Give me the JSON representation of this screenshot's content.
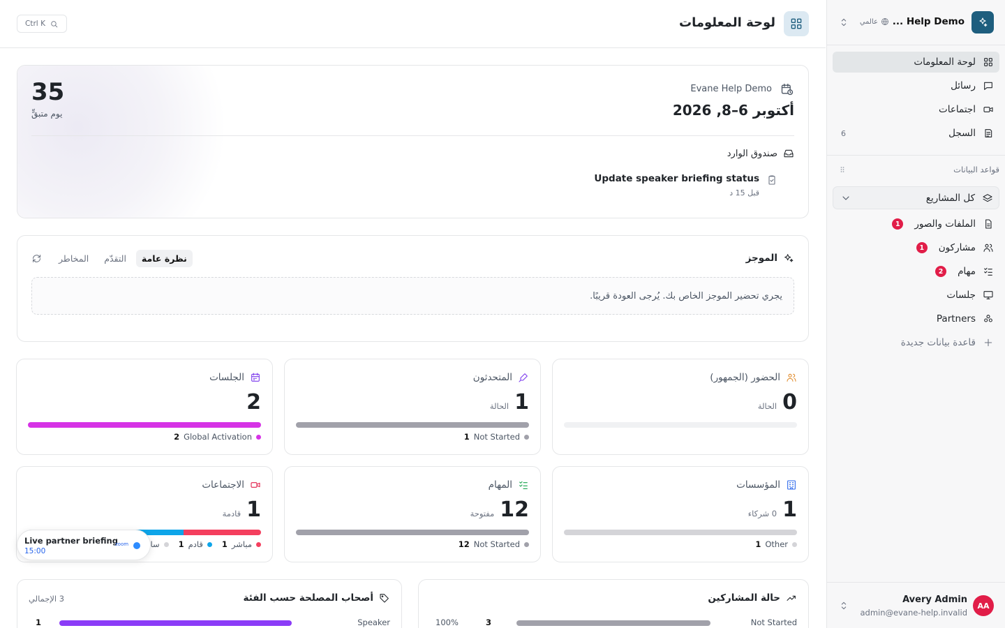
{
  "workspace": {
    "name": "Help Demo ...",
    "scope": "عالمي"
  },
  "header": {
    "title": "لوحة المعلومات",
    "search_shortcut": "Ctrl K"
  },
  "nav": [
    {
      "label": "لوحة المعلومات",
      "icon": "dashboard-icon",
      "active": true
    },
    {
      "label": "رسائل",
      "icon": "message-icon"
    },
    {
      "label": "اجتماعات",
      "icon": "video-icon"
    },
    {
      "label": "السجل",
      "icon": "log-icon",
      "count": "6"
    }
  ],
  "databases": {
    "section_title": "قواعد البيانات",
    "all_label": "كل المشاريع",
    "items": [
      {
        "label": "الملفات والصور",
        "badge": "1"
      },
      {
        "label": "مشاركون",
        "badge": "1"
      },
      {
        "label": "مهام",
        "badge": "2"
      },
      {
        "label": "جلسات"
      },
      {
        "label": "Partners"
      }
    ],
    "new_label": "قاعدة بيانات جديدة"
  },
  "user": {
    "initials": "AA",
    "name": "Avery Admin",
    "email": "admin@evane-help.invalid"
  },
  "event": {
    "name": "Evane Help Demo",
    "dates": "أكتوبر 6–8, 2026",
    "days_left": "35",
    "days_label": "يوم متبقٍّ",
    "inbox_title": "صندوق الوارد",
    "inbox_item": {
      "title": "Update speaker briefing status",
      "time": "قبل 15 د"
    }
  },
  "briefing": {
    "title": "الموجز",
    "tabs": [
      "نظرة عامة",
      "التقدّم",
      "المخاطر"
    ],
    "message": "يجري تحضير الموجز الخاص بك. يُرجى العودة قريبًا."
  },
  "stats": [
    {
      "title": "الحضور (الجمهور)",
      "value": "0",
      "label": "الحالة",
      "icon": "users-icon",
      "icon_color": "#e08a2b",
      "segments": [],
      "legend": []
    },
    {
      "title": "المتحدثون",
      "value": "1",
      "label": "الحالة",
      "icon": "mic-icon",
      "icon_color": "#7c3aed",
      "segments": [
        {
          "frac": 1,
          "color": "#a1a1aa"
        }
      ],
      "legend": [
        {
          "count": "1",
          "label": "Not Started",
          "color": "#a1a1aa"
        }
      ]
    },
    {
      "title": "الجلسات",
      "value": "2",
      "label": "",
      "icon": "calendar-icon",
      "icon_color": "#7c3aed",
      "segments": [
        {
          "frac": 1,
          "color": "#d633e6"
        }
      ],
      "legend": [
        {
          "count": "2",
          "label": "Global Activation",
          "color": "#d633e6"
        }
      ]
    },
    {
      "title": "المؤسسات",
      "value": "1",
      "label": "0 شركاء",
      "icon": "building-icon",
      "icon_color": "#2563eb",
      "segments": [
        {
          "frac": 1,
          "color": "#d4d4d8"
        }
      ],
      "legend": [
        {
          "count": "1",
          "label": "Other",
          "color": "#d4d4d8"
        }
      ]
    },
    {
      "title": "المهام",
      "value": "12",
      "label": "مفتوحة",
      "icon": "tasks-icon",
      "icon_color": "#16a34a",
      "segments": [
        {
          "frac": 1,
          "color": "#a1a1aa"
        }
      ],
      "legend": [
        {
          "count": "12",
          "label": "Not Started",
          "color": "#a1a1aa"
        }
      ]
    },
    {
      "title": "الاجتماعات",
      "value": "1",
      "label": "قادمة",
      "icon": "video-icon",
      "icon_color": "#e11d48",
      "segments": [
        {
          "frac": 0.333,
          "color": "#f43f5e"
        },
        {
          "frac": 0.333,
          "color": "#0ea5e9"
        },
        {
          "frac": 0.334,
          "color": "#d4d4d8"
        }
      ],
      "legend": [
        {
          "count": "1",
          "label": "مباشر",
          "color": "#f43f5e"
        },
        {
          "count": "1",
          "label": "قادم",
          "color": "#0ea5e9"
        },
        {
          "count": "",
          "label": "سابق",
          "color": "#d4d4d8"
        }
      ]
    }
  ],
  "live_meeting": {
    "title": "Live partner briefing",
    "time": "15:00",
    "provider": "zoom"
  },
  "stakeholders": {
    "title": "أصحاب المصلحة حسب الفئة",
    "total": "3 الإجمالي",
    "row": {
      "label": "Speaker",
      "count": "1",
      "frac": 0.95
    }
  },
  "participants": {
    "title": "حالة المشاركين",
    "row": {
      "label": "Not Started",
      "count": "3",
      "pct": "100%"
    }
  }
}
